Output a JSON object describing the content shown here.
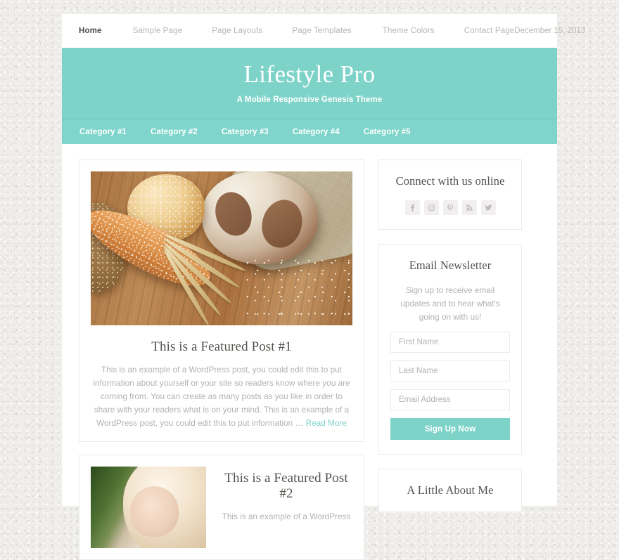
{
  "topnav": {
    "items": [
      {
        "label": "Home",
        "current": true
      },
      {
        "label": "Sample Page",
        "current": false
      },
      {
        "label": "Page Layouts",
        "current": false
      },
      {
        "label": "Page Templates",
        "current": false
      },
      {
        "label": "Theme Colors",
        "current": false
      },
      {
        "label": "Contact Page",
        "current": false
      }
    ],
    "date": "December 15, 2013"
  },
  "header": {
    "title": "Lifestyle Pro",
    "tagline": "A Mobile Responsive Genesis Theme",
    "background_color": "#7ed3c9"
  },
  "category_nav": {
    "items": [
      {
        "label": "Category #1"
      },
      {
        "label": "Category #2"
      },
      {
        "label": "Category #3"
      },
      {
        "label": "Category #4"
      },
      {
        "label": "Category #5"
      }
    ],
    "background_color": "#7fd5cb"
  },
  "posts": [
    {
      "title": "This is a Featured Post #1",
      "excerpt": "This is an example of a WordPress post, you could edit this to put information about yourself or your site so readers know where you are coming from. You can create as many posts as you like in order to share with your readers what is on your mind. This is an example of a WordPress post, you could edit this to put information … ",
      "read_more": "Read More",
      "image_alt": "assorted breads and wheat stalks on a wooden table"
    },
    {
      "title": "This is a Featured Post #2",
      "excerpt": "This is an example of a WordPress",
      "image_alt": "portrait of a blonde woman outdoors"
    }
  ],
  "sidebar": {
    "connect": {
      "title": "Connect with us online",
      "icons": [
        {
          "name": "facebook-icon"
        },
        {
          "name": "instagram-icon"
        },
        {
          "name": "pinterest-icon"
        },
        {
          "name": "rss-icon"
        },
        {
          "name": "twitter-icon"
        }
      ]
    },
    "newsletter": {
      "title": "Email Newsletter",
      "description": "Sign up to receive email updates and to hear what's going on with us!",
      "first_name_placeholder": "First Name",
      "first_name_value": "",
      "last_name_placeholder": "Last Name",
      "last_name_value": "",
      "email_placeholder": "Email Address",
      "email_value": "",
      "submit_label": "Sign Up Now",
      "accent_color": "#7ed3c9"
    },
    "about": {
      "title": "A Little About Me"
    }
  }
}
